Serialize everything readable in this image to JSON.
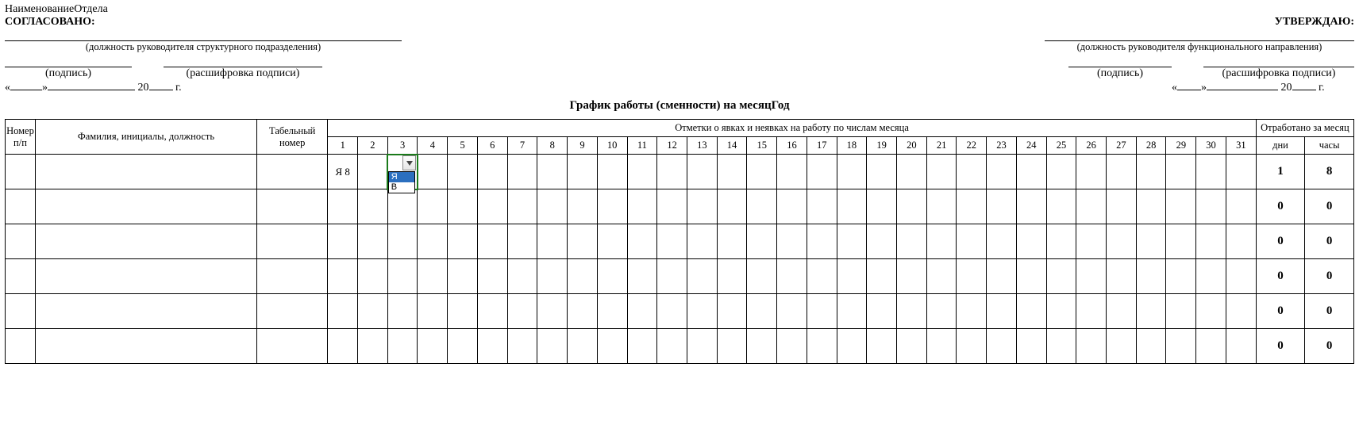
{
  "header": {
    "dept_label": "НаименованиеОтдела",
    "agree_label": "СОГЛАСОВАНО:",
    "approve_label": "УТВЕРЖДАЮ:",
    "left_position_caption": "(должность руководителя структурного подразделения)",
    "right_position_caption": "(должность руководителя функционального направления)",
    "signature_caption": "(подпись)",
    "decode_caption": "(расшифровка подписи)",
    "date_open": "«",
    "date_mid": "»",
    "date_year_prefix": "20",
    "date_year_suffix": "г.",
    "title": "График работы (сменности) на месяцГод"
  },
  "table": {
    "col_num": "Номер п/п",
    "col_fio": "Фамилия, инициалы, должность",
    "col_tab": "Табельный номер",
    "col_marks": "Отметки о явках и неявках на работу по числам месяца",
    "col_total": "Отработано за месяц",
    "col_days": "дни",
    "col_hours": "часы",
    "day_numbers": [
      "1",
      "2",
      "3",
      "4",
      "5",
      "6",
      "7",
      "8",
      "9",
      "10",
      "11",
      "12",
      "13",
      "14",
      "15",
      "16",
      "17",
      "18",
      "19",
      "20",
      "21",
      "22",
      "23",
      "24",
      "25",
      "26",
      "27",
      "28",
      "29",
      "30",
      "31"
    ]
  },
  "dropdown": {
    "options": [
      "Я",
      "В"
    ],
    "selected_index": 0
  },
  "rows": [
    {
      "num": "",
      "fio": "",
      "tab": "",
      "days": [
        "Я 8",
        "",
        "",
        "",
        "",
        "",
        "",
        "",
        "",
        "",
        "",
        "",
        "",
        "",
        "",
        "",
        "",
        "",
        "",
        "",
        "",
        "",
        "",
        "",
        "",
        "",
        "",
        "",
        "",
        "",
        ""
      ],
      "tot_days": "1",
      "tot_hours": "8"
    },
    {
      "num": "",
      "fio": "",
      "tab": "",
      "days": [
        "",
        "",
        "",
        "",
        "",
        "",
        "",
        "",
        "",
        "",
        "",
        "",
        "",
        "",
        "",
        "",
        "",
        "",
        "",
        "",
        "",
        "",
        "",
        "",
        "",
        "",
        "",
        "",
        "",
        "",
        ""
      ],
      "tot_days": "0",
      "tot_hours": "0"
    },
    {
      "num": "",
      "fio": "",
      "tab": "",
      "days": [
        "",
        "",
        "",
        "",
        "",
        "",
        "",
        "",
        "",
        "",
        "",
        "",
        "",
        "",
        "",
        "",
        "",
        "",
        "",
        "",
        "",
        "",
        "",
        "",
        "",
        "",
        "",
        "",
        "",
        "",
        ""
      ],
      "tot_days": "0",
      "tot_hours": "0"
    },
    {
      "num": "",
      "fio": "",
      "tab": "",
      "days": [
        "",
        "",
        "",
        "",
        "",
        "",
        "",
        "",
        "",
        "",
        "",
        "",
        "",
        "",
        "",
        "",
        "",
        "",
        "",
        "",
        "",
        "",
        "",
        "",
        "",
        "",
        "",
        "",
        "",
        "",
        ""
      ],
      "tot_days": "0",
      "tot_hours": "0"
    },
    {
      "num": "",
      "fio": "",
      "tab": "",
      "days": [
        "",
        "",
        "",
        "",
        "",
        "",
        "",
        "",
        "",
        "",
        "",
        "",
        "",
        "",
        "",
        "",
        "",
        "",
        "",
        "",
        "",
        "",
        "",
        "",
        "",
        "",
        "",
        "",
        "",
        "",
        ""
      ],
      "tot_days": "0",
      "tot_hours": "0"
    },
    {
      "num": "",
      "fio": "",
      "tab": "",
      "days": [
        "",
        "",
        "",
        "",
        "",
        "",
        "",
        "",
        "",
        "",
        "",
        "",
        "",
        "",
        "",
        "",
        "",
        "",
        "",
        "",
        "",
        "",
        "",
        "",
        "",
        "",
        "",
        "",
        "",
        "",
        ""
      ],
      "tot_days": "0",
      "tot_hours": "0"
    }
  ]
}
